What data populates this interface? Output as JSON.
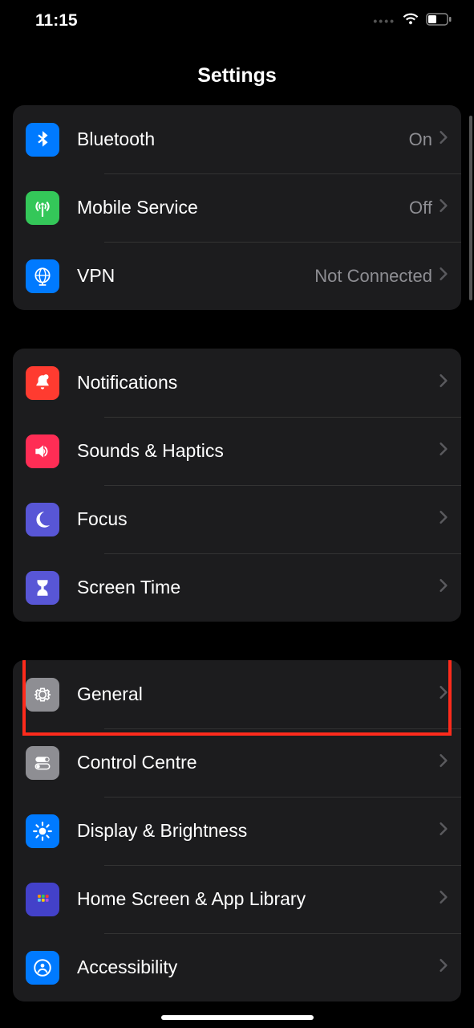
{
  "status": {
    "time": "11:15"
  },
  "header": {
    "title": "Settings"
  },
  "groups": [
    {
      "rows": [
        {
          "id": "bluetooth",
          "label": "Bluetooth",
          "value": "On",
          "icon_bg": "#007aff"
        },
        {
          "id": "mobile-service",
          "label": "Mobile Service",
          "value": "Off",
          "icon_bg": "#34c759"
        },
        {
          "id": "vpn",
          "label": "VPN",
          "value": "Not Connected",
          "icon_bg": "#007aff"
        }
      ]
    },
    {
      "rows": [
        {
          "id": "notifications",
          "label": "Notifications",
          "icon_bg": "#ff3b30"
        },
        {
          "id": "sounds-haptics",
          "label": "Sounds & Haptics",
          "icon_bg": "#ff2d55"
        },
        {
          "id": "focus",
          "label": "Focus",
          "icon_bg": "#5856d6"
        },
        {
          "id": "screen-time",
          "label": "Screen Time",
          "icon_bg": "#5856d6"
        }
      ]
    },
    {
      "rows": [
        {
          "id": "general",
          "label": "General",
          "icon_bg": "#8e8e93",
          "highlighted": true
        },
        {
          "id": "control-centre",
          "label": "Control Centre",
          "icon_bg": "#8e8e93"
        },
        {
          "id": "display-brightness",
          "label": "Display & Brightness",
          "icon_bg": "#007aff"
        },
        {
          "id": "home-screen",
          "label": "Home Screen & App Library",
          "icon_bg": "#4341c9"
        },
        {
          "id": "accessibility",
          "label": "Accessibility",
          "icon_bg": "#007aff"
        }
      ]
    }
  ],
  "icons": {
    "bluetooth": "bluetooth-icon",
    "mobile-service": "antenna-icon",
    "vpn": "globe-icon",
    "notifications": "bell-icon",
    "sounds-haptics": "speaker-icon",
    "focus": "moon-icon",
    "screen-time": "hourglass-icon",
    "general": "gear-icon",
    "control-centre": "toggles-icon",
    "display-brightness": "sun-icon",
    "home-screen": "grid-icon",
    "accessibility": "person-circle-icon"
  }
}
